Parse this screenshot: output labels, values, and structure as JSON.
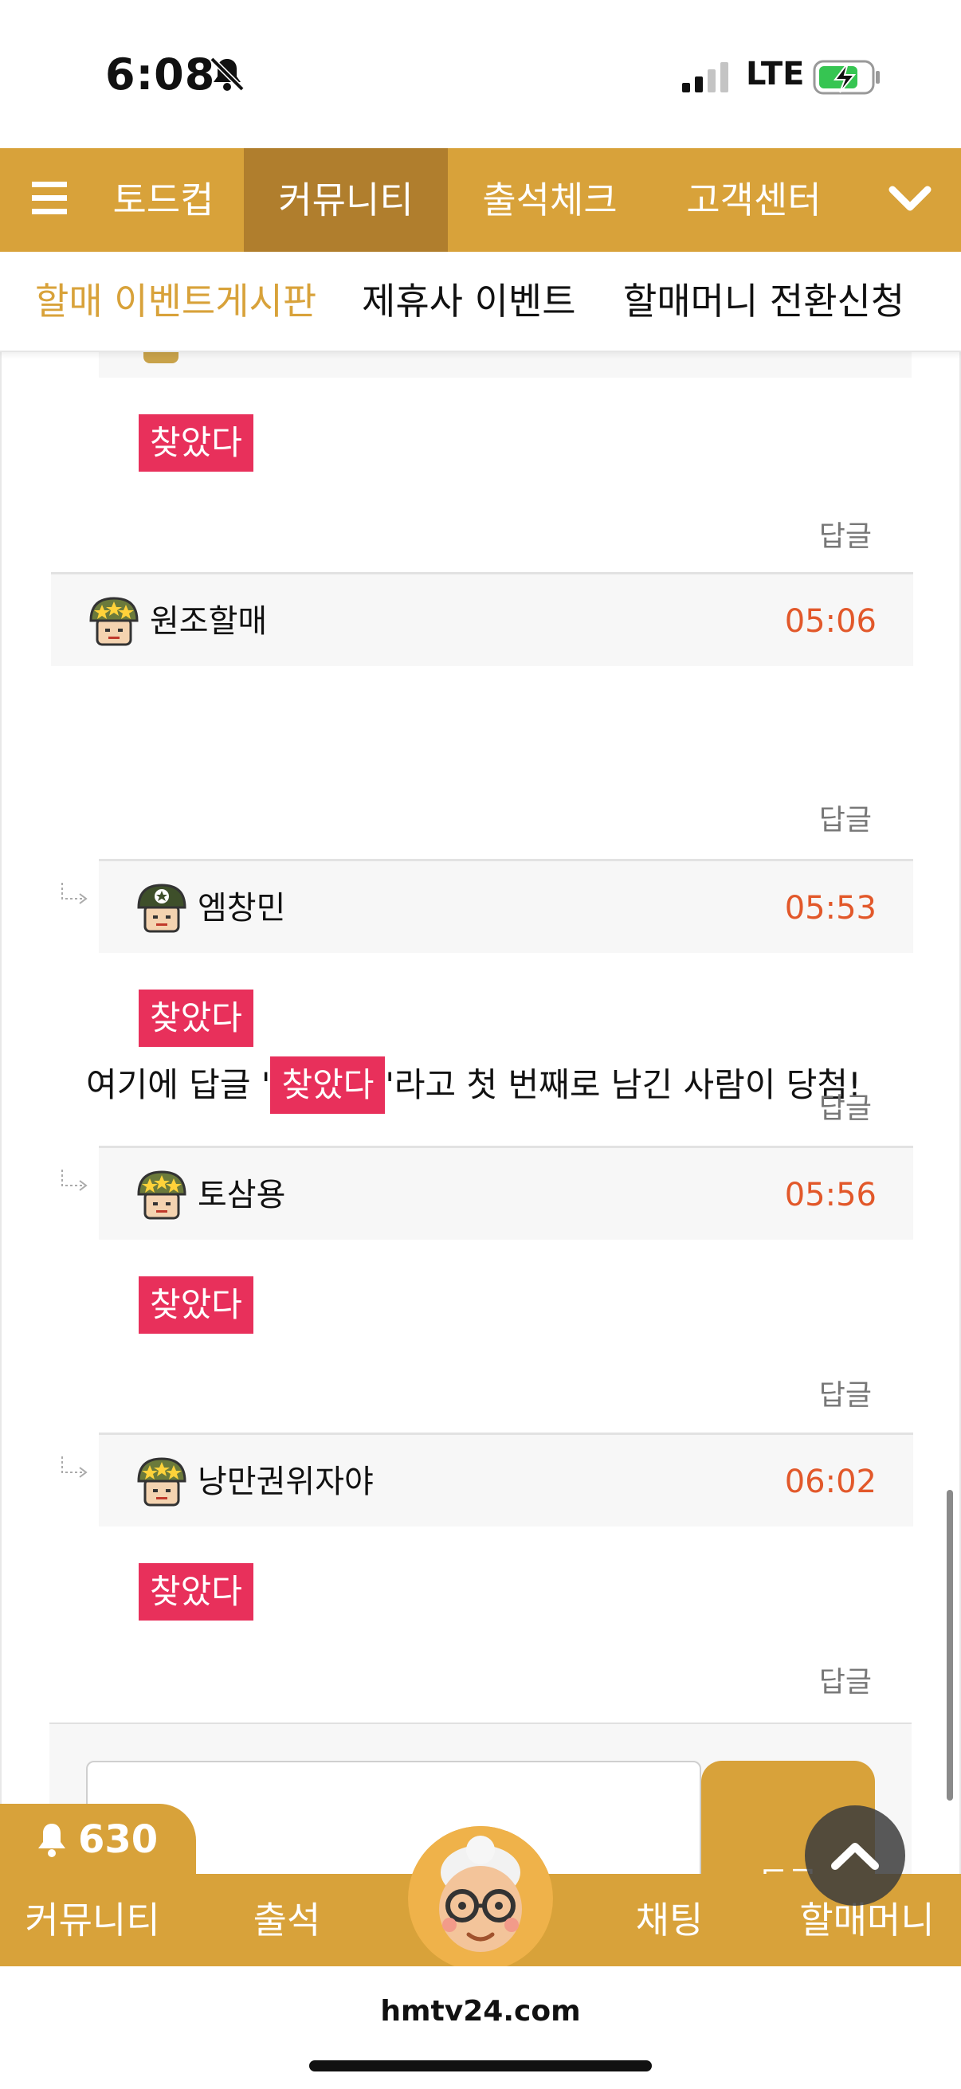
{
  "status_bar": {
    "time": "6:08",
    "network": "LTE"
  },
  "top_nav": {
    "items": [
      "토드컵",
      "커뮤니티",
      "출석체크",
      "고객센터"
    ],
    "active_index": 1
  },
  "sub_nav": {
    "items": [
      "할매 이벤트게시판",
      "제휴사 이벤트",
      "할매머니 전환신청"
    ],
    "active_index": 0
  },
  "comments": {
    "found_label": "찾았다",
    "reply_label": "답글",
    "main": {
      "author": "원조할매",
      "time": "05:06",
      "text_before": "여기에 답글 '",
      "text_highlight": "찾았다",
      "text_after": "'라고 첫 번째로 남긴 사람이 당첨!"
    },
    "replies": [
      {
        "author": "엠창민",
        "time": "05:53"
      },
      {
        "author": "토삼용",
        "time": "05:56"
      },
      {
        "author": "낭만권위자야",
        "time": "06:02"
      }
    ]
  },
  "write": {
    "submit_label": "등록"
  },
  "bottom_bar": {
    "notification_count": "630",
    "tabs": [
      "커뮤니티",
      "출석",
      "채팅",
      "할매머니"
    ]
  },
  "browser": {
    "url": "hmtv24.com"
  },
  "colors": {
    "brand": "#d8a23a",
    "brand_dark": "#b07e2d",
    "highlight": "#e8305b",
    "time": "#e2582a"
  }
}
